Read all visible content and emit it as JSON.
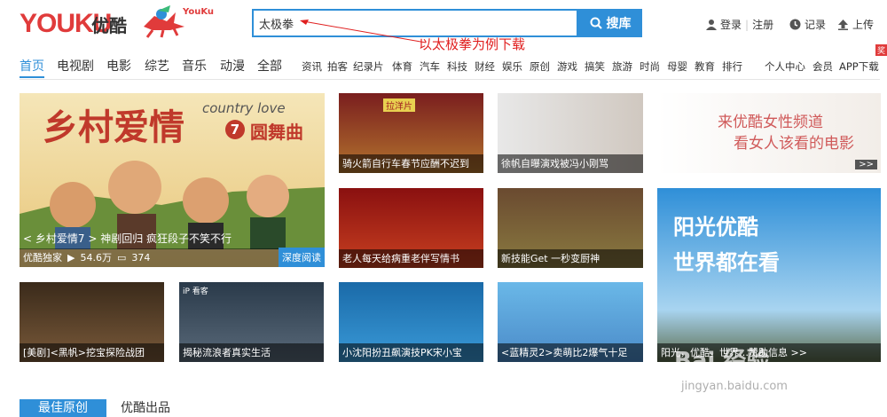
{
  "logo": {
    "text": "YOUKU",
    "cn": "优酷",
    "mascot_label": "YouKu"
  },
  "search": {
    "value": "太极拳",
    "button": "搜库"
  },
  "annotation": "以太极拳为例下载",
  "top_right": {
    "login": "登录",
    "register": "注册",
    "record": "记录",
    "upload": "上传"
  },
  "nav": {
    "main": [
      "首页",
      "电视剧",
      "电影",
      "综艺",
      "音乐",
      "动漫",
      "全部"
    ],
    "sub": [
      "资讯",
      "拍客",
      "纪录片",
      "体育",
      "汽车",
      "科技",
      "财经",
      "娱乐",
      "原创",
      "游戏",
      "搞笑",
      "旅游",
      "时尚",
      "母婴",
      "教育",
      "排行"
    ],
    "right": [
      "个人中心",
      "会员",
      "APP下载"
    ],
    "badge": "奖"
  },
  "hero": {
    "title_cn": "乡村爱情",
    "title_en": "country love",
    "episode": "7",
    "dance": "圆舞曲",
    "caption": "< 乡村爱情7 > 神剧回归 疯狂段子不笑不行",
    "source": "优酷独家",
    "views": "54.6万",
    "comments": "374",
    "tag": "深度阅读"
  },
  "tiles": [
    {
      "caption": "骑火箭自行车春节应酬不迟到",
      "sign": "拉洋片"
    },
    {
      "caption": "徐帆自曝演戏被冯小刚骂"
    },
    {
      "caption": "老人每天给病重老伴写情书"
    },
    {
      "caption": "新技能Get 一秒变厨神"
    },
    {
      "caption": "[美剧]<黑帆>挖宝探险战团"
    },
    {
      "caption": "揭秘流浪者真实生活",
      "logo": "iP 看客"
    },
    {
      "caption": "小沈阳扮丑飙演技PK宋小宝"
    },
    {
      "caption": "<蓝精灵2>卖萌比2爆气十足"
    }
  ],
  "ad_women": {
    "line1": "来优酷女性频道",
    "line2": "看女人该看的电影",
    "more": ">>"
  },
  "ad_sun": {
    "line1": "阳光优酷",
    "line2": "世界都在看",
    "caption": "阳光，优酷，世界…赞助信息 >>"
  },
  "watermark": {
    "brand": "Bai 经验",
    "url": "jingyan.baidu.com"
  },
  "bottom_tabs": [
    "最佳原创",
    "优酷出品"
  ],
  "colors": {
    "brand_blue": "#2f8fd8",
    "brand_red": "#e03b3b",
    "annotation_red": "#e02020"
  }
}
